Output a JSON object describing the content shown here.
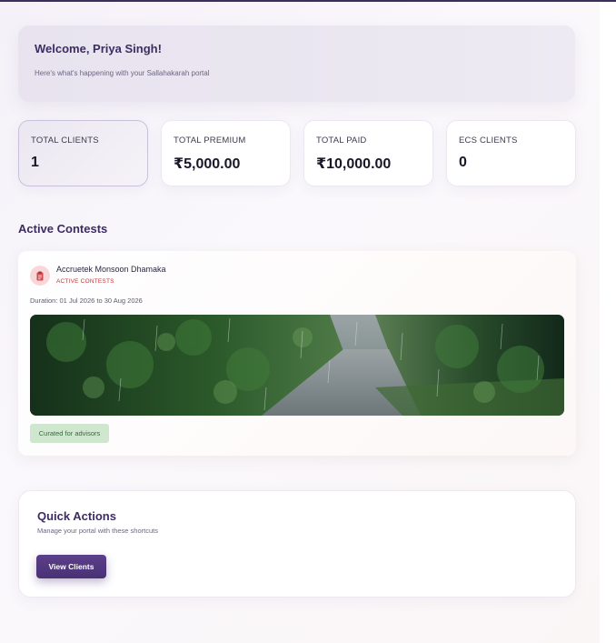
{
  "welcome": {
    "title": "Welcome, Priya Singh!",
    "subtitle": "Here's what's happening with your Sallahakarah portal"
  },
  "stats": [
    {
      "label": "TOTAL CLIENTS",
      "value": "1"
    },
    {
      "label": "TOTAL PREMIUM",
      "value": "₹5,000.00"
    },
    {
      "label": "TOTAL PAID",
      "value": "₹10,000.00"
    },
    {
      "label": "ECS CLIENTS",
      "value": "0"
    }
  ],
  "contests": {
    "section_title": "Active Contests",
    "card": {
      "icon": "clipboard-icon",
      "name": "Accruetek Monsoon Dhamaka",
      "tag": "ACTIVE CONTESTS",
      "duration": "Duration: 01 Jul 2026 to 30 Aug 2026",
      "badge": "Curated for advisors"
    }
  },
  "quick_actions": {
    "title": "Quick Actions",
    "subtitle": "Manage your portal with these shortcuts",
    "button_label": "View Clients"
  },
  "colors": {
    "accent": "#3d2c63",
    "button": "#4a3175",
    "contest_tag": "#c0353b",
    "badge_bg": "#cfe6cf"
  }
}
